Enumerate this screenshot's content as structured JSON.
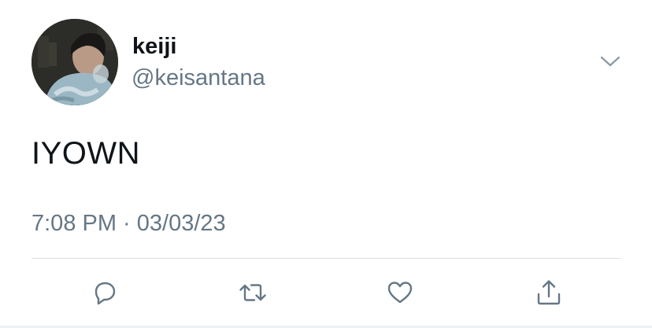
{
  "tweet": {
    "author": {
      "display_name": "keiji",
      "handle": "@keisantana",
      "avatar_icon": "profile-photo"
    },
    "text": "IYOWN",
    "meta": {
      "time": "7:08 PM",
      "separator": " · ",
      "date": "03/03/23"
    },
    "menu_icon": "chevron-down-icon",
    "actions": [
      {
        "name": "reply",
        "icon": "reply-icon"
      },
      {
        "name": "retweet",
        "icon": "retweet-icon"
      },
      {
        "name": "like",
        "icon": "heart-icon"
      },
      {
        "name": "share",
        "icon": "share-icon"
      }
    ]
  },
  "colors": {
    "text_primary": "#0f1419",
    "text_secondary": "#657786",
    "icon": "#657786",
    "divider": "#d9dee2"
  }
}
